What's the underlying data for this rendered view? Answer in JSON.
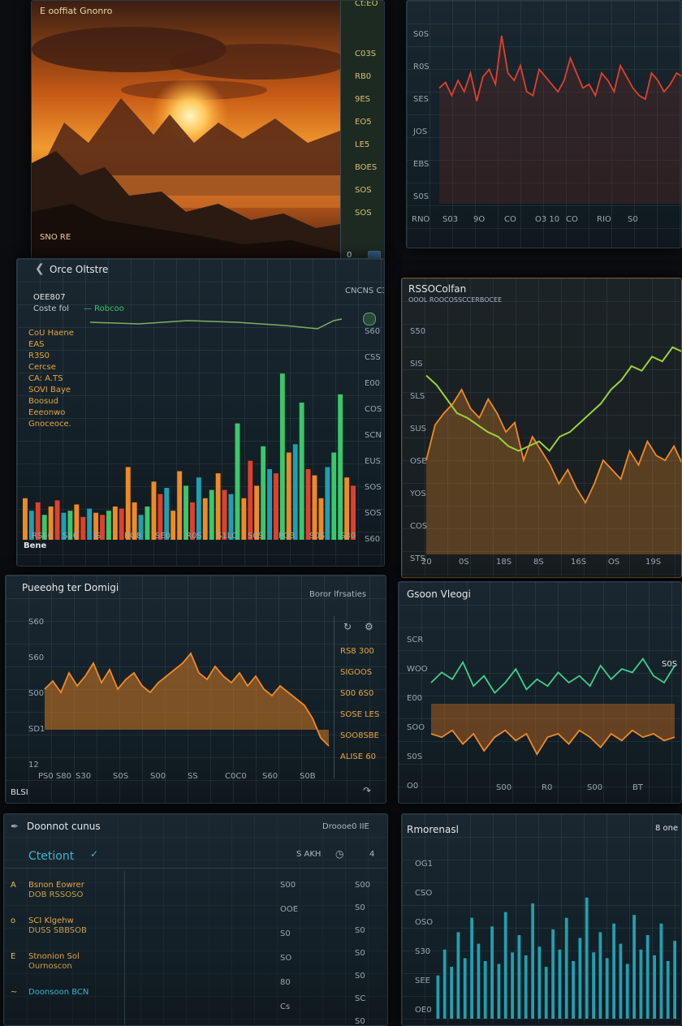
{
  "colors": {
    "orange": "#f08a24",
    "red": "#e0402c",
    "green": "#39c86a",
    "teal": "#1fa0b0",
    "yellow_green": "#9ed03a"
  },
  "panel1": {
    "title": "E ooffiat Gnonro",
    "corner": "Ct:EO",
    "side_labels": [
      "C03S",
      "RB0",
      "9ES",
      "EO5",
      "LE5",
      "BOES",
      "SOS",
      "SOS"
    ],
    "footer_left": "SNO RE",
    "footer_btn1": "0",
    "footer_btn2": "S"
  },
  "panel2": {
    "y_labels": [
      "S0S",
      "R0S",
      "SES",
      "JOS",
      "EBS",
      "S0S"
    ],
    "x_labels": [
      "RNO",
      "S03",
      "9O",
      "CO",
      "O3 10",
      "CO",
      "RIO",
      "S0"
    ]
  },
  "panel3": {
    "header": "Orce Oltstre",
    "header_right": "CNCNS C3",
    "legend_title": "OEE807",
    "legend_sub": "Coste fol",
    "legend_badge": "— Robcoo",
    "labels_left": [
      "CoU Haene",
      "EAS",
      "R3S0",
      "Cercse",
      "CA: A.TS",
      "SOVI Baye",
      "Boosud",
      "Eeeonwo",
      "Gnoceoce."
    ],
    "y_labels": [
      "S60",
      "CSS",
      "E00",
      "COS",
      "SCN",
      "EUS",
      "SOS",
      "SOS",
      "S60"
    ],
    "x_labels": [
      "RS60",
      "S60",
      "IS",
      "RO8",
      "SE0",
      "R0S",
      "S1LC",
      "S0S",
      "PO3",
      "S0S",
      "S30"
    ],
    "footer": "Bene"
  },
  "panel4": {
    "title": "RSSOColfan",
    "subtitle": "OOOL ROOCOSSCCERBOCEE",
    "y_labels": [
      "S50",
      "SIS",
      "SLS",
      "SUS",
      "OSE",
      "YOS",
      "COS",
      "STS"
    ],
    "x_labels": [
      "20",
      "0S",
      "18S",
      "8S",
      "16S",
      "OS",
      "19S"
    ]
  },
  "panel5": {
    "title": "Pueeohg ter Domigi",
    "title_right": "Boror lfrsaties",
    "side_labels": [
      "RS8 300",
      "SIGOOS",
      "S00 6S0",
      "SOSE LES",
      "SOO8SBE",
      "ALISE 60"
    ],
    "y_labels": [
      "S60",
      "S60",
      "S00",
      "SD1",
      "12"
    ],
    "x_labels": [
      "PS0 S80",
      "S30",
      "S0S",
      "S00",
      "SS",
      "C0C0",
      "S60",
      "S0B"
    ],
    "footer": "BLSI"
  },
  "panel6": {
    "title": "Gsoon Vleogi",
    "y_labels": [
      "SCR",
      "WOO",
      "E00",
      "SOO",
      "S0S",
      "O0"
    ],
    "right_label": "S0S",
    "x_labels": [
      "S00",
      "R0",
      "S00",
      "BT"
    ]
  },
  "panel7": {
    "title": "Doonnot cunus",
    "title_right": "Droooe0 IIE",
    "subheader": "Ctetiont",
    "subheader_right": "S AKH",
    "subheader_num": "4",
    "rows": [
      {
        "main": "Bsnon Eowrer",
        "sub": "DOB RSSOSO",
        "icon": "A"
      },
      {
        "main": "SCI Klgehw",
        "sub": "DUSS SBBSOB",
        "icon": "o"
      },
      {
        "main": "Stnonion Sol",
        "sub": "Ournoscon",
        "icon": "E"
      },
      {
        "main": "Doonsoon BCN",
        "sub": "",
        "icon": "~"
      }
    ],
    "col_values": [
      "S00",
      "OOE",
      "S0",
      "SO",
      "80",
      "Cs"
    ],
    "right_values": [
      "S00",
      "S0",
      "S0",
      "S0",
      "S0",
      "SC",
      "S0"
    ]
  },
  "panel8": {
    "title": "Rmorenasl",
    "title_right": "8 one",
    "y_labels": [
      "OG1",
      "CSO",
      "OSO",
      "S30",
      "SEE",
      "OE0"
    ]
  },
  "chart_data": [
    {
      "type": "bar",
      "name_ref": "panel3",
      "values": [
        20,
        14,
        18,
        12,
        16,
        19,
        13,
        14,
        17,
        11,
        15,
        13,
        12,
        14,
        16,
        15,
        35,
        18,
        12,
        16,
        28,
        22,
        25,
        14,
        33,
        26,
        18,
        30,
        20,
        24,
        32,
        24,
        22,
        56,
        20,
        38,
        26,
        45,
        34,
        32,
        80,
        42,
        46,
        66,
        34,
        31,
        20,
        35,
        42,
        70,
        30,
        26
      ],
      "colors": [
        "orange",
        "teal",
        "red",
        "green",
        "orange",
        "red",
        "teal",
        "green",
        "orange",
        "red",
        "teal",
        "orange",
        "red",
        "green",
        "orange",
        "red",
        "orange",
        "orange",
        "teal",
        "green",
        "orange",
        "red",
        "teal",
        "orange",
        "orange",
        "green",
        "red",
        "teal",
        "orange",
        "green",
        "orange",
        "red",
        "teal",
        "green",
        "orange",
        "red",
        "orange",
        "green",
        "teal",
        "red",
        "green",
        "orange",
        "teal",
        "green",
        "red",
        "orange",
        "orange",
        "teal",
        "green",
        "green",
        "orange",
        "red"
      ]
    },
    {
      "type": "line",
      "name_ref": "panel2",
      "values": [
        62,
        65,
        58,
        66,
        60,
        70,
        55,
        68,
        72,
        64,
        90,
        70,
        66,
        74,
        60,
        58,
        72,
        68,
        64,
        60,
        66,
        78,
        70,
        62,
        64,
        58,
        70,
        66,
        60,
        74,
        68,
        62,
        58,
        56,
        70,
        66,
        60,
        64,
        70,
        68
      ]
    },
    {
      "type": "area",
      "name_ref": "panel5",
      "values": [
        50,
        55,
        48,
        60,
        52,
        58,
        66,
        54,
        62,
        50,
        56,
        60,
        52,
        48,
        54,
        58,
        62,
        66,
        72,
        60,
        56,
        64,
        58,
        54,
        60,
        52,
        58,
        50,
        46,
        52,
        48,
        44,
        40,
        32,
        20,
        15
      ]
    },
    {
      "type": "line",
      "name_ref": "panel4_orange",
      "values": [
        40,
        55,
        60,
        64,
        70,
        62,
        58,
        66,
        60,
        52,
        56,
        40,
        50,
        44,
        38,
        30,
        36,
        28,
        22,
        30,
        40,
        36,
        32,
        44,
        38,
        48,
        42,
        40,
        46,
        38
      ]
    },
    {
      "type": "line",
      "name_ref": "panel4_green",
      "values": [
        76,
        72,
        66,
        60,
        58,
        55,
        52,
        50,
        46,
        44,
        46,
        48,
        44,
        50,
        52,
        56,
        60,
        64,
        70,
        74,
        80,
        78,
        84,
        82,
        88,
        86
      ]
    },
    {
      "type": "line",
      "name_ref": "panel6_green",
      "values": [
        60,
        66,
        62,
        72,
        58,
        64,
        54,
        60,
        68,
        56,
        62,
        58,
        66,
        60,
        64,
        58,
        70,
        62,
        68,
        66,
        74,
        64,
        60,
        70
      ]
    },
    {
      "type": "area",
      "name_ref": "panel6_orange",
      "values": [
        30,
        28,
        32,
        24,
        30,
        20,
        28,
        32,
        26,
        30,
        18,
        28,
        30,
        24,
        32,
        28,
        22,
        30,
        26,
        32,
        28,
        30,
        26,
        28
      ]
    },
    {
      "type": "bar",
      "name_ref": "panel8",
      "values": [
        30,
        48,
        36,
        60,
        42,
        70,
        52,
        40,
        64,
        38,
        74,
        46,
        58,
        44,
        80,
        50,
        36,
        62,
        48,
        70,
        40,
        56,
        84,
        46,
        60,
        42,
        66,
        52,
        38,
        72,
        48,
        58,
        44,
        66,
        40,
        54
      ]
    }
  ]
}
